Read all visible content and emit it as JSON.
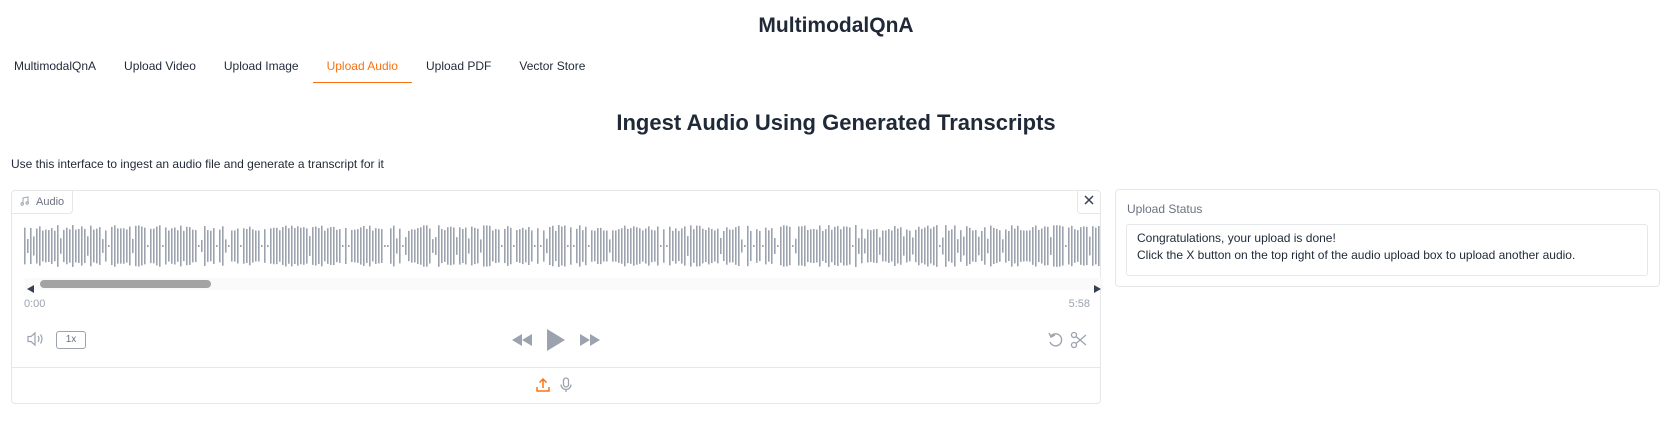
{
  "app": {
    "title": "MultimodalQnA"
  },
  "tabs": [
    {
      "label": "MultimodalQnA",
      "active": false
    },
    {
      "label": "Upload Video",
      "active": false
    },
    {
      "label": "Upload Image",
      "active": false
    },
    {
      "label": "Upload Audio",
      "active": true
    },
    {
      "label": "Upload PDF",
      "active": false
    },
    {
      "label": "Vector Store",
      "active": false
    }
  ],
  "section": {
    "heading": "Ingest Audio Using Generated Transcripts",
    "description": "Use this interface to ingest an audio file and generate a transcript for it"
  },
  "audio": {
    "label": "Audio",
    "current_time": "0:00",
    "duration": "5:58",
    "playback_rate": "1x",
    "scroll_position": 0.0
  },
  "status": {
    "label": "Upload Status",
    "lines": [
      "Congratulations, your upload is done!",
      "Click the X button on the top right of the audio upload box to upload another audio."
    ]
  },
  "colors": {
    "accent": "#f97316",
    "waveform": "#9ca3af",
    "border": "#e5e7eb",
    "muted_text": "#6b7280"
  },
  "icons": {
    "audio_label": "music-note-icon",
    "clear": "close-icon",
    "scroll_left": "triangle-left-icon",
    "scroll_right": "triangle-right-icon",
    "volume": "volume-icon",
    "skip_back": "rewind-icon",
    "play": "play-icon",
    "skip_forward": "fast-forward-icon",
    "reset": "undo-icon",
    "trim": "scissors-icon",
    "upload": "upload-icon",
    "microphone": "microphone-icon"
  }
}
